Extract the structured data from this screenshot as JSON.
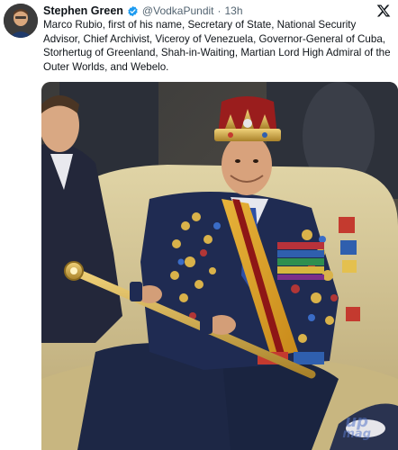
{
  "post": {
    "author": {
      "display_name": "Stephen Green",
      "handle": "@VodkaPundit",
      "verified": true,
      "verified_color": "#1d9bf0"
    },
    "separator": "·",
    "time": "13h",
    "text": "Marco Rubio, first of his name, Secretary of State, National Security Advisor, Chief Archivist, Viceroy of Venezuela, Governor-General of Cuba, Storhertug of Greenland, Shah-in-Waiting, Martian Lord High Admiral of the Outer Worlds, and Webelo.",
    "platform_icon": "x-logo-icon",
    "media": {
      "watermark_line1": "up",
      "watermark_line2": "mag"
    }
  },
  "colors": {
    "text_primary": "#0f1419",
    "text_secondary": "#536471",
    "couch": "#c9b98a",
    "crown_gold": "#c9a43a",
    "fez_red": "#8f1c1c",
    "jacket_navy": "#1e2a4a"
  }
}
